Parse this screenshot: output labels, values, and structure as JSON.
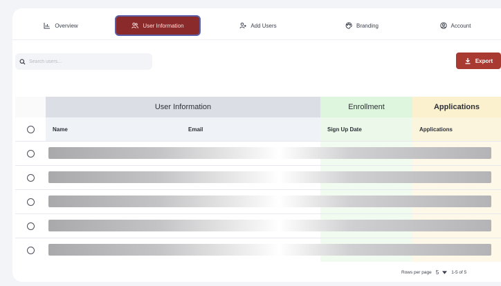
{
  "nav": {
    "items": [
      {
        "label": "Overview",
        "icon": "chart-icon",
        "active": false
      },
      {
        "label": "User Information",
        "icon": "users-icon",
        "active": true
      },
      {
        "label": "Add Users",
        "icon": "add-user-icon",
        "active": false
      },
      {
        "label": "Branding",
        "icon": "palette-icon",
        "active": false
      },
      {
        "label": "Account",
        "icon": "account-icon",
        "active": false
      }
    ]
  },
  "search": {
    "placeholder": "Search users...",
    "value": ""
  },
  "toolbar": {
    "export_label": "Export"
  },
  "table": {
    "groups": {
      "user": "User Information",
      "enrollment": "Enrollment",
      "applications": "Applications"
    },
    "columns": {
      "name": "Name",
      "email": "Email",
      "signup": "Sign Up Date",
      "applications": "Applications"
    },
    "row_count": 5
  },
  "pagination": {
    "rows_label": "Rows per page",
    "rows_value": "5",
    "range": "1-5 of 5"
  },
  "colors": {
    "accent": "#a83a32",
    "active_tab": "#8b2a2a",
    "enroll_bg": "#dff6de",
    "apps_bg": "#fbf1cf",
    "user_bg": "#dcdee5"
  }
}
